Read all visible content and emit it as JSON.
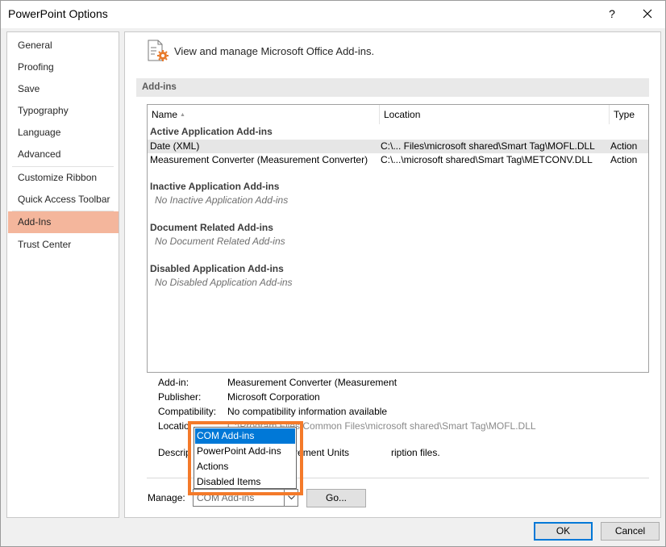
{
  "window": {
    "title": "PowerPoint Options",
    "help_label": "?"
  },
  "nav": {
    "items": [
      {
        "label": "General"
      },
      {
        "label": "Proofing"
      },
      {
        "label": "Save"
      },
      {
        "label": "Typography"
      },
      {
        "label": "Language"
      },
      {
        "label": "Advanced"
      },
      {
        "label": "Customize Ribbon"
      },
      {
        "label": "Quick Access Toolbar"
      },
      {
        "label": "Add-Ins",
        "selected": true
      },
      {
        "label": "Trust Center"
      }
    ]
  },
  "main": {
    "header_text": "View and manage Microsoft Office Add-ins.",
    "section_title": "Add-ins",
    "table": {
      "columns": {
        "name": "Name",
        "location": "Location",
        "type": "Type"
      },
      "groups": [
        {
          "title": "Active Application Add-ins",
          "rows": [
            {
              "name": "Date (XML)",
              "location": "C:\\... Files\\microsoft shared\\Smart Tag\\MOFL.DLL",
              "type": "Action"
            },
            {
              "name": "Measurement Converter (Measurement Converter)",
              "location": "C:\\...\\microsoft shared\\Smart Tag\\METCONV.DLL",
              "type": "Action"
            }
          ]
        },
        {
          "title": "Inactive Application Add-ins",
          "empty": "No Inactive Application Add-ins"
        },
        {
          "title": "Document Related Add-ins",
          "empty": "No Document Related Add-ins"
        },
        {
          "title": "Disabled Application Add-ins",
          "empty": "No Disabled Application Add-ins"
        }
      ]
    },
    "details": {
      "addin_label": "Add-in:",
      "addin_value": "Measurement Converter (Measurement",
      "publisher_label": "Publisher:",
      "publisher_value": "Microsoft Corporation",
      "compat_label": "Compatibility:",
      "compat_value": "No compatibility information available",
      "location_label": "Locatio",
      "location_value": "C:\\Program Files\\Common Files\\microsoft shared\\Smart Tag\\MOFL.DLL",
      "description_label": "Descrip",
      "description_value": "Measurement Units",
      "description_value2": "ription files."
    },
    "manage": {
      "label": "Manage:",
      "selected": "COM Add-ins",
      "go_label": "Go...",
      "options": [
        "COM Add-ins",
        "PowerPoint Add-ins",
        "Actions",
        "Disabled Items"
      ]
    }
  },
  "buttons": {
    "ok": "OK",
    "cancel": "Cancel"
  },
  "colors": {
    "selected_nav": "#f4b69c",
    "dropdown_highlight": "#0078d7",
    "callout_frame": "#f47a2a"
  }
}
